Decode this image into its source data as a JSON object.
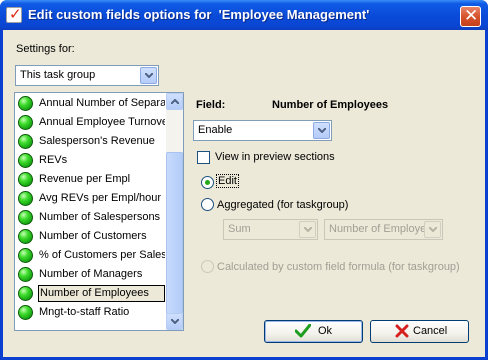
{
  "window": {
    "title": "Edit custom fields options for  'Employee Management'"
  },
  "settings": {
    "label": "Settings for:",
    "selected": "This task group"
  },
  "list": {
    "items": [
      "Annual Number of  Separa",
      "Annual Employee Turnove",
      "Salesperson's Revenue",
      "REVs",
      "Revenue per Empl",
      "Avg REVs per Empl/hour",
      "Number of Salespersons",
      "Number of Customers",
      "% of Customers per Salesp",
      "Number of Managers",
      "Number of Employees",
      "Mngt-to-staff Ratio"
    ],
    "selected_index": 10
  },
  "field": {
    "label": "Field:",
    "name": "Number of Employees",
    "enable_selected": "Enable",
    "view_in_preview_label": "View in preview sections",
    "view_in_preview_checked": false,
    "edit_label": "Edit",
    "edit_selected": true,
    "aggregated_label": "Aggregated (for taskgroup)",
    "aggregated_selected": false,
    "agg_function": "Sum",
    "agg_field": "Number of Employe",
    "calculated_label": "Calculated by custom field formula (for taskgroup)",
    "calculated_selected": false
  },
  "buttons": {
    "ok": "Ok",
    "cancel": "Cancel"
  },
  "colors": {
    "titlebar": "#0a4ad8",
    "dialog_bg": "#ece9d8",
    "ok_check": "#1e9c1e",
    "cancel_x": "#d62020"
  }
}
